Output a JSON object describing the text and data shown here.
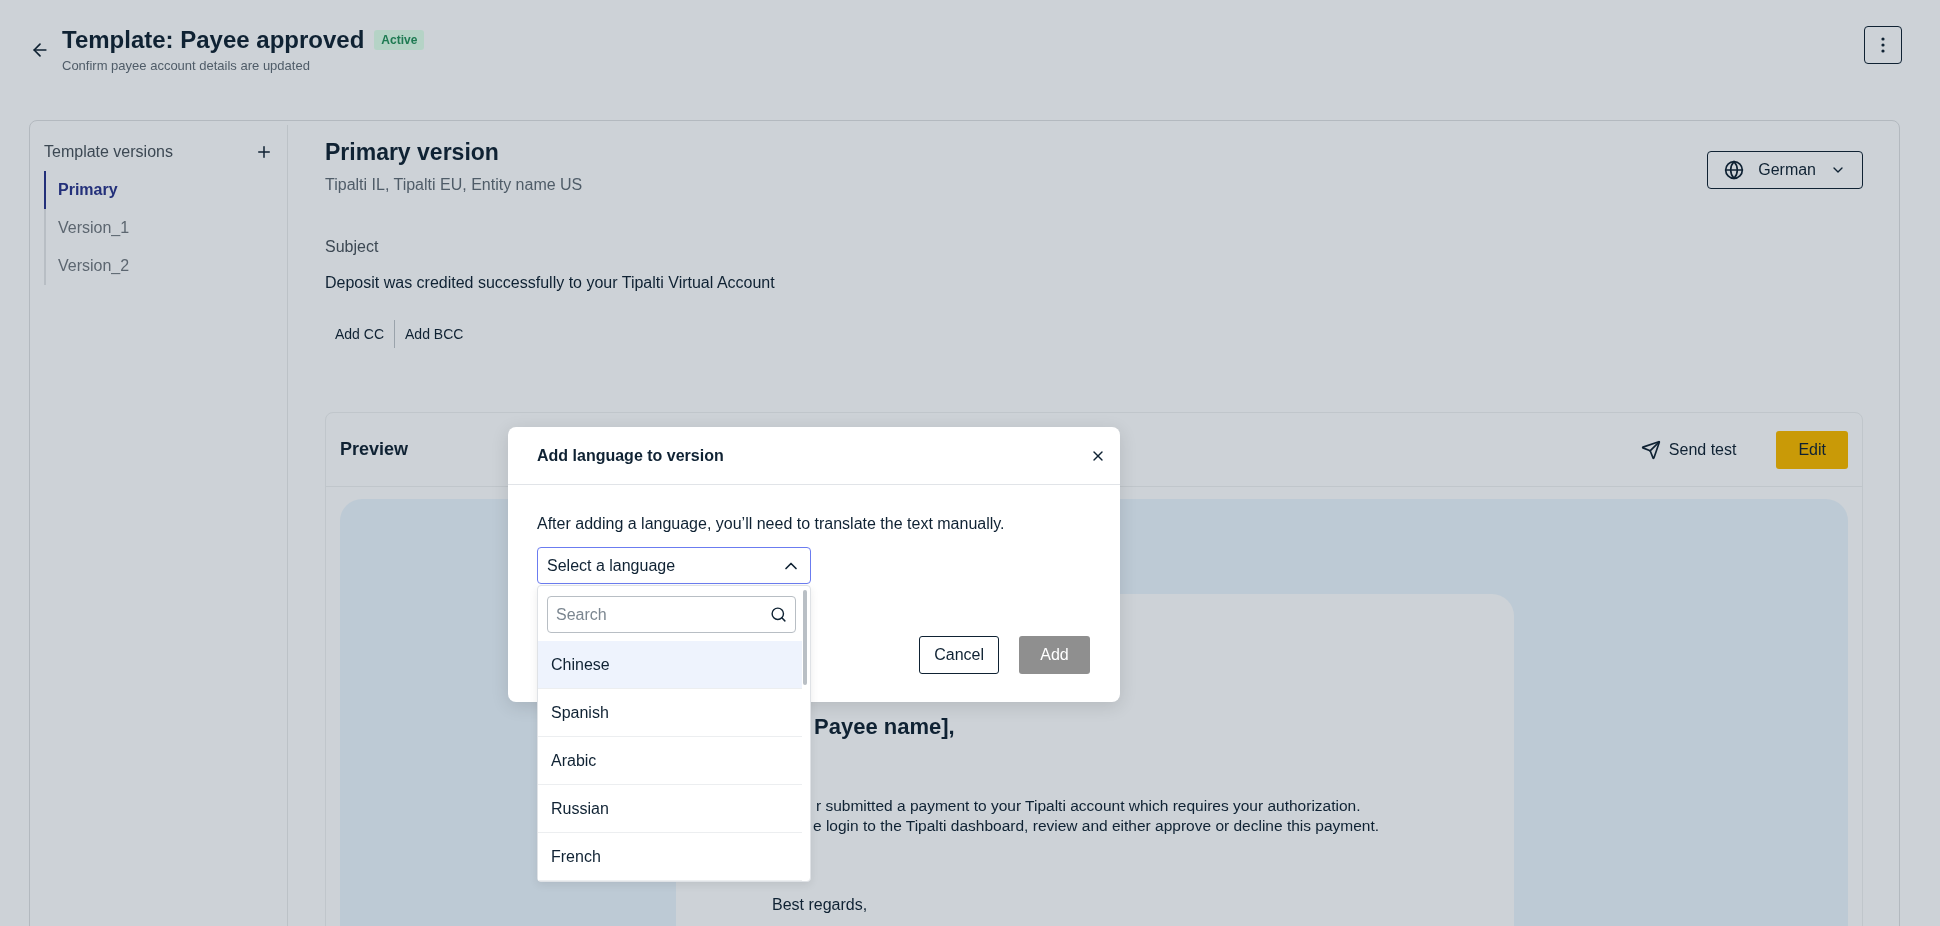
{
  "header": {
    "title": "Template: Payee approved",
    "status": "Active",
    "subtitle": "Confirm payee account details are updated"
  },
  "sidebar": {
    "title": "Template versions",
    "items": [
      {
        "label": "Primary",
        "selected": true
      },
      {
        "label": "Version_1",
        "selected": false
      },
      {
        "label": "Version_2",
        "selected": false
      }
    ]
  },
  "version": {
    "title": "Primary version",
    "entities": "Tipalti IL, Tipalti EU, Entity name US",
    "language": "German",
    "subject_label": "Subject",
    "subject": "Deposit was credited successfully to your Tipalti Virtual Account",
    "recipient_actions": [
      "Add CC",
      "Add BCC"
    ]
  },
  "preview": {
    "title": "Preview",
    "send_test": "Send test",
    "edit": "Edit",
    "email": {
      "greeting": "Payee name],",
      "body": [
        "r submitted a payment to your Tipalti account which requires your authorization.",
        "e login to the Tipalti dashboard, review and either approve or decline this payment."
      ],
      "signoff": "Best regards,"
    }
  },
  "dialog": {
    "title": "Add language to version",
    "description": "After adding a language, you’ll need to translate the text manually.",
    "select": {
      "placeholder": "Select a language",
      "expanded": true
    },
    "search": {
      "placeholder": "Search"
    },
    "options": [
      {
        "label": "Chinese",
        "selected": true
      },
      {
        "label": "Spanish",
        "selected": false
      },
      {
        "label": "Arabic",
        "selected": false
      },
      {
        "label": "Russian",
        "selected": false
      },
      {
        "label": "French",
        "selected": false
      }
    ],
    "buttons": [
      {
        "label": "Cancel",
        "disabled": false
      },
      {
        "label": "Add",
        "disabled": true
      }
    ]
  }
}
